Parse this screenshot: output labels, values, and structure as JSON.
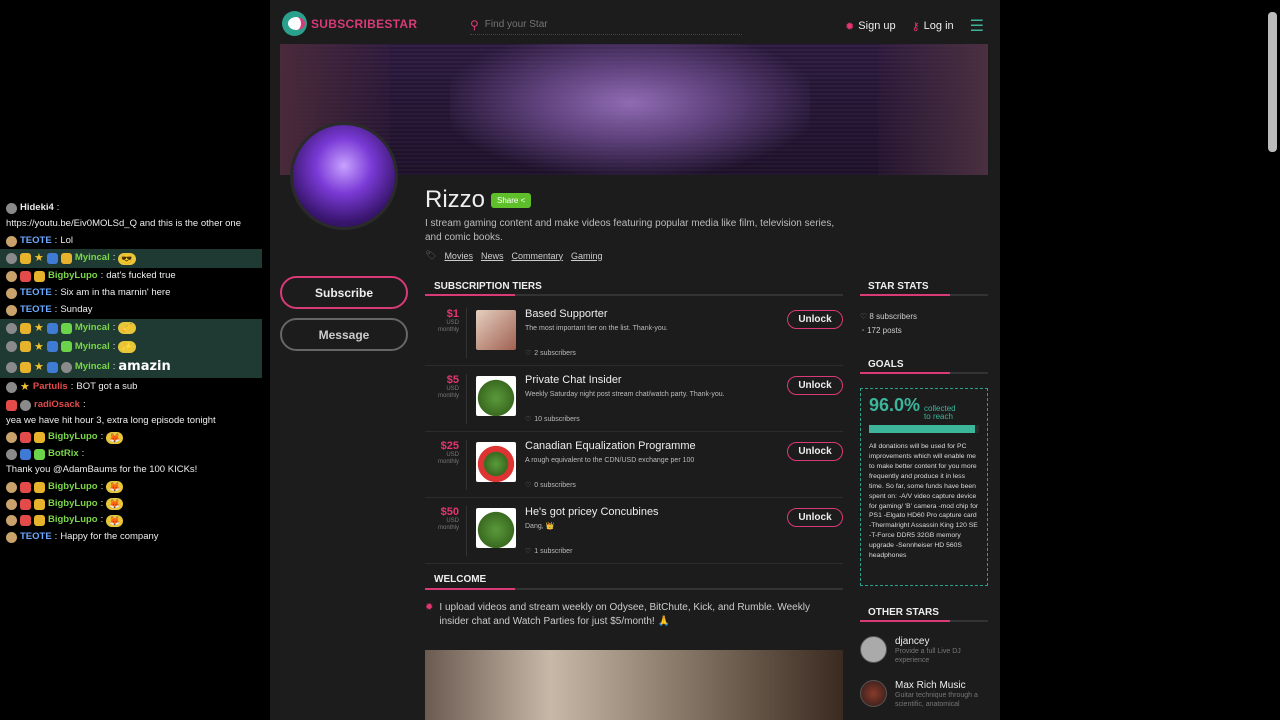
{
  "chat": [
    {
      "badges": [
        "gray"
      ],
      "user": "Hideki4",
      "user_color": "#e9e9e9",
      "text": "https://youtu.be/Eiv0MOLSd_Q and this is the other one"
    },
    {
      "badges": [
        "round"
      ],
      "user": "TEOTE",
      "user_color": "#6aa9ff",
      "text": "Lol"
    },
    {
      "badges": [
        "gray",
        "gold",
        "star",
        "blue",
        "gold"
      ],
      "user": "Myincal",
      "user_color": "#7ad64a",
      "text": "",
      "emote": "😎",
      "highlight": true
    },
    {
      "badges": [
        "round",
        "red",
        "gold"
      ],
      "user": "BigbyLupo",
      "user_color": "#7ad64a",
      "text": "dat's fucked true"
    },
    {
      "badges": [
        "round"
      ],
      "user": "TEOTE",
      "user_color": "#6aa9ff",
      "text": "Six am in tha marnin' here"
    },
    {
      "badges": [
        "round"
      ],
      "user": "TEOTE",
      "user_color": "#6aa9ff",
      "text": "Sunday"
    },
    {
      "badges": [
        "gray",
        "gold",
        "star",
        "blue",
        "green"
      ],
      "user": "Myincal",
      "user_color": "#7ad64a",
      "text": "",
      "emote": "🎺",
      "highlight": true
    },
    {
      "badges": [
        "gray",
        "gold",
        "star",
        "blue",
        "green"
      ],
      "user": "Myincal",
      "user_color": "#7ad64a",
      "text": "",
      "emote": "✨",
      "highlight": true
    },
    {
      "badges": [
        "gray",
        "gold",
        "star",
        "blue",
        "gray"
      ],
      "user": "Myincal",
      "user_color": "#7ad64a",
      "text": "amazin",
      "highlight": true,
      "big": true
    },
    {
      "badges": [
        "gray",
        "star"
      ],
      "user": "Partulis",
      "user_color": "#e34a4a",
      "text": "BOT got a sub"
    },
    {
      "badges": [
        "red",
        "gray"
      ],
      "user": "radiOsack",
      "user_color": "#e34a4a",
      "text": "yea we have hit hour 3, extra long episode tonight"
    },
    {
      "badges": [
        "round",
        "red",
        "gold"
      ],
      "user": "BigbyLupo",
      "user_color": "#7ad64a",
      "text": "",
      "emote": "🦊"
    },
    {
      "badges": [
        "gray",
        "blue",
        "green"
      ],
      "user": "BotRix",
      "user_color": "#7ad64a",
      "text": "Thank you @AdamBaums for the 100 KICKs!"
    },
    {
      "badges": [
        "round",
        "red",
        "gold"
      ],
      "user": "BigbyLupo",
      "user_color": "#7ad64a",
      "text": "",
      "emote": "🦊"
    },
    {
      "badges": [
        "round",
        "red",
        "gold"
      ],
      "user": "BigbyLupo",
      "user_color": "#7ad64a",
      "text": "",
      "emote": "🦊"
    },
    {
      "badges": [
        "round",
        "red",
        "gold"
      ],
      "user": "BigbyLupo",
      "user_color": "#7ad64a",
      "text": "",
      "emote": "🦊"
    },
    {
      "badges": [
        "round"
      ],
      "user": "TEOTE",
      "user_color": "#6aa9ff",
      "text": "Happy for the company"
    }
  ],
  "header": {
    "logo_text": "SUBSCRIBESTAR",
    "search_placeholder": "Find your Star",
    "signup_label": "Sign up",
    "login_label": "Log in"
  },
  "profile": {
    "name": "Rizzo",
    "share_label": "Share <",
    "bio": "I stream gaming content and make videos featuring popular media like film, television series, and comic books.",
    "tags": [
      "Movies",
      "News",
      "Commentary",
      "Gaming"
    ],
    "subscribe_label": "Subscribe",
    "message_label": "Message"
  },
  "sections": {
    "tiers_title": "SUBSCRIPTION TIERS",
    "stats_title": "STAR STATS",
    "goals_title": "GOALS",
    "welcome_title": "WELCOME",
    "other_title": "OTHER STARS"
  },
  "tiers": [
    {
      "price": "$1",
      "currency": "USD",
      "period": "monthly",
      "title": "Based Supporter",
      "desc": "The most important tier on the list. Thank-you.",
      "subs": "2 subscribers",
      "unlock": "Unlock",
      "img": "pic"
    },
    {
      "price": "$5",
      "currency": "USD",
      "period": "monthly",
      "title": "Private Chat Insider",
      "desc": "Weekly Saturday night post stream chat/watch party. Thank-you.",
      "subs": "10 subscribers",
      "unlock": "Unlock",
      "img": "green"
    },
    {
      "price": "$25",
      "currency": "USD",
      "period": "monthly",
      "title": "Canadian Equalization Programme",
      "desc": "A rough equivalent to the CDN/USD exchange per 100",
      "subs": "0 subscribers",
      "unlock": "Unlock",
      "img": "red"
    },
    {
      "price": "$50",
      "currency": "USD",
      "period": "monthly",
      "title": "He's got pricey Concubines",
      "desc": "Dang, 👑",
      "subs": "1 subscriber",
      "unlock": "Unlock",
      "img": "green"
    }
  ],
  "stats": {
    "subscribers": "8 subscribers",
    "posts": "172 posts"
  },
  "goal": {
    "percent": "96.0%",
    "percent_value": 96.0,
    "caption": "collected to reach",
    "desc": "All donations will be used for PC improvements which will enable me to make better content for you more frequently and produce it in less time. So far, some funds have been spent on: -A/V video capture device for gaming/ 'B' camera -mod chip for PS1 -Elgato HD60 Pro capture card -Thermalright Assassin King 120 SE -T-Force DDR5 32GB memory upgrade -Sennheiser HD 560S headphones"
  },
  "welcome": "I upload videos and stream weekly on Odysee, BitChute, Kick, and Rumble. Weekly insider chat and Watch Parties for just $5/month! 🙏",
  "other_stars": [
    {
      "name": "djancey",
      "desc": "Provide a full Live DJ experience"
    },
    {
      "name": "Max Rich Music",
      "desc": "Guitar technique through a scientific, anatomical"
    }
  ]
}
